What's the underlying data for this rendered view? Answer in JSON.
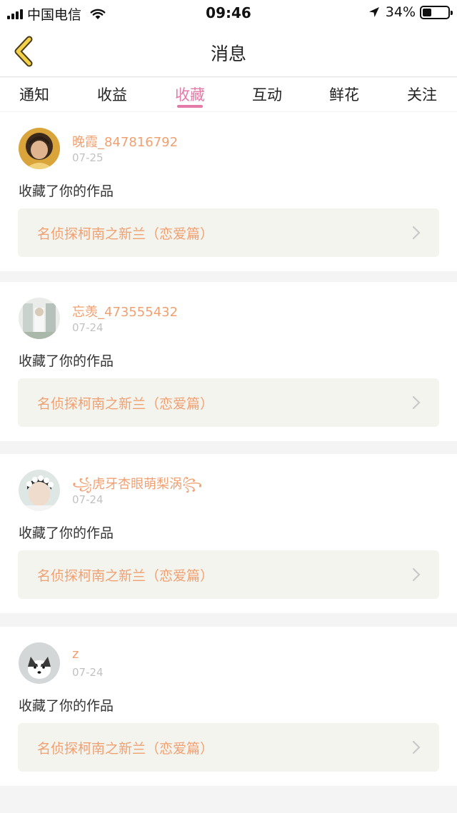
{
  "status": {
    "carrier": "中国电信",
    "time": "09:46",
    "battery": "34%"
  },
  "header": {
    "title": "消息"
  },
  "tabs": [
    {
      "label": "通知"
    },
    {
      "label": "收益"
    },
    {
      "label": "收藏"
    },
    {
      "label": "互动"
    },
    {
      "label": "鲜花"
    },
    {
      "label": "关注"
    }
  ],
  "active_tab": "收藏",
  "colors": {
    "accent_pink": "#e37aa8",
    "username_orange": "#f0a071",
    "back_yellow": "#f3d24a"
  },
  "messages": [
    {
      "username": "晚霞_847816792",
      "date": "07-25",
      "action": "收藏了你的作品",
      "work": "名侦探柯南之新兰（恋爱篇）"
    },
    {
      "username": "忘羡_473555432",
      "date": "07-24",
      "action": "收藏了你的作品",
      "work": "名侦探柯南之新兰（恋爱篇）"
    },
    {
      "username": "꧁虎牙杏眼萌梨涡꧂",
      "date": "07-24",
      "action": "收藏了你的作品",
      "work": "名侦探柯南之新兰（恋爱篇）"
    },
    {
      "username": "z",
      "date": "07-24",
      "action": "收藏了你的作品",
      "work": "名侦探柯南之新兰（恋爱篇）"
    }
  ]
}
